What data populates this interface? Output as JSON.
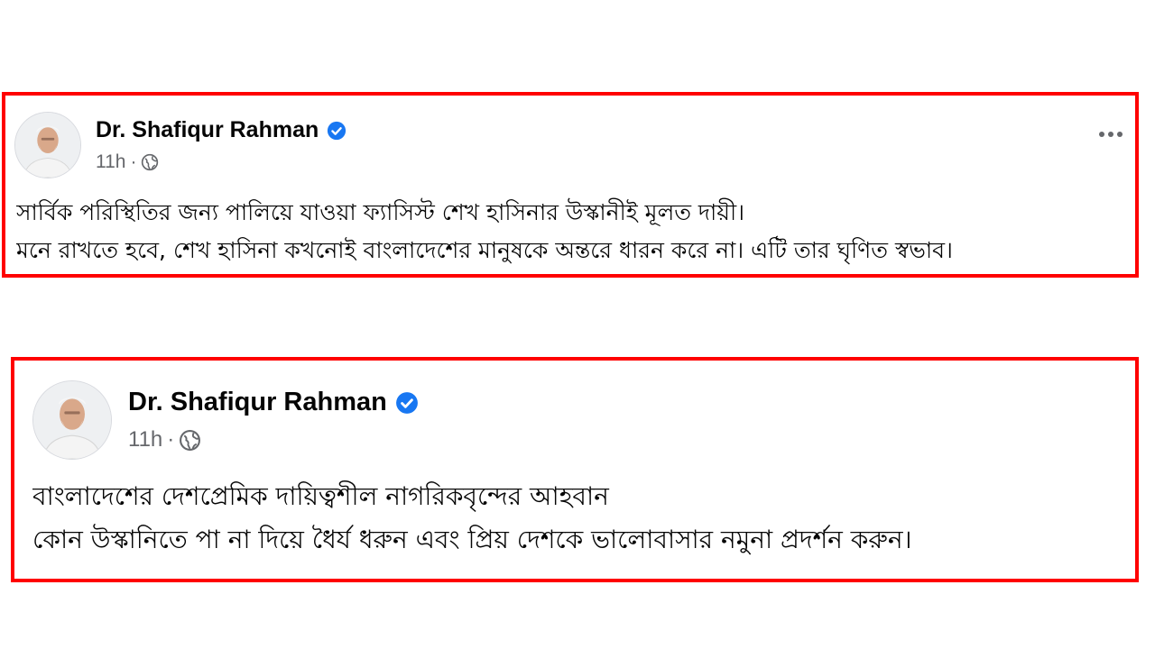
{
  "posts": [
    {
      "author": "Dr. Shafiqur Rahman",
      "time": "11h",
      "separator": "·",
      "lines": [
        "সার্বিক পরিস্থিতির জন্য পালিয়ে যাওয়া ফ্যাসিস্ট শেখ হাসিনার উস্কানীই মূলত দায়ী।",
        "মনে রাখতে হবে, শেখ হাসিনা কখনোই বাংলাদেশের মানুষকে অন্তরে ধারন করে না। এটি তার ঘৃণিত স্বভাব।"
      ]
    },
    {
      "author": "Dr. Shafiqur Rahman",
      "time": "11h",
      "separator": "·",
      "lines": [
        "বাংলাদেশের দেশপ্রেমিক দায়িত্বশীল নাগরিকবৃন্দের আহবান",
        "কোন উস্কানিতে পা না দিয়ে ধৈর্য ধরুন এবং প্রিয় দেশকে ভালোবাসার নমুনা প্রদর্শন করুন।"
      ]
    }
  ],
  "icons": {
    "verified": "verified-badge-icon",
    "audience": "globe-icon",
    "more": "more-options-icon"
  },
  "colors": {
    "highlight_border": "#ff0000",
    "verified_blue": "#1877f2",
    "meta_gray": "#65676b",
    "text": "#050505"
  }
}
